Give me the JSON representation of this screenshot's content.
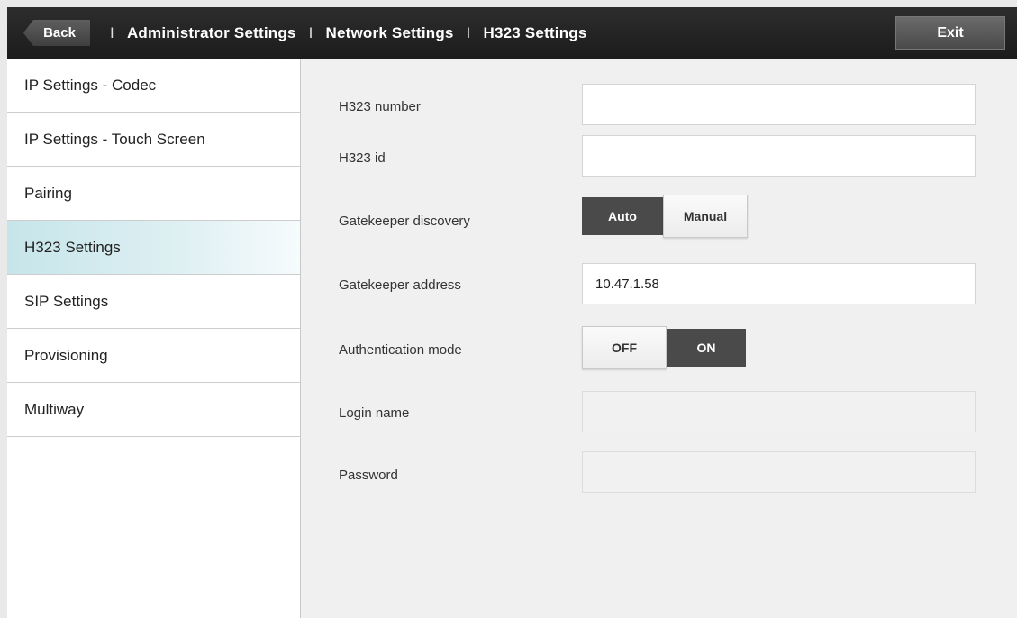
{
  "header": {
    "back_label": "Back",
    "breadcrumbs": [
      "Administrator Settings",
      "Network Settings",
      "H323 Settings"
    ],
    "separator": "I",
    "exit_label": "Exit"
  },
  "sidebar": {
    "items": [
      {
        "label": "IP Settings - Codec"
      },
      {
        "label": "IP Settings - Touch Screen"
      },
      {
        "label": "Pairing"
      },
      {
        "label": "H323 Settings",
        "active": true
      },
      {
        "label": "SIP Settings"
      },
      {
        "label": "Provisioning"
      },
      {
        "label": "Multiway"
      }
    ]
  },
  "form": {
    "h323_number": {
      "label": "H323 number",
      "value": ""
    },
    "h323_id": {
      "label": "H323 id",
      "value": ""
    },
    "gatekeeper_discovery": {
      "label": "Gatekeeper discovery",
      "options": [
        "Auto",
        "Manual"
      ],
      "selected": "Auto"
    },
    "gatekeeper_address": {
      "label": "Gatekeeper address",
      "value": "10.47.1.58"
    },
    "authentication_mode": {
      "label": "Authentication mode",
      "options": [
        "OFF",
        "ON"
      ],
      "selected": "ON"
    },
    "login_name": {
      "label": "Login name",
      "value": ""
    },
    "password": {
      "label": "Password",
      "value": ""
    }
  },
  "colors": {
    "header_bg": "#1c1c1c",
    "active_item": "#c6e5ea",
    "toggle_selected": "#4a4a4a"
  }
}
